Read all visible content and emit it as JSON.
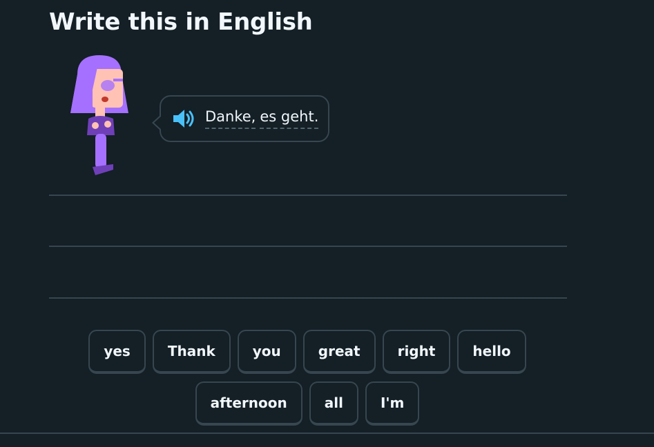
{
  "header": {
    "title": "Write this in English"
  },
  "prompt": {
    "words": [
      "Danke,",
      "es geht."
    ]
  },
  "word_bank": {
    "row1": [
      "yes",
      "Thank",
      "you",
      "great",
      "right",
      "hello"
    ],
    "row2": [
      "afternoon",
      "all",
      "I'm"
    ]
  },
  "colors": {
    "background": "#141f26",
    "border": "#37464f",
    "text": "#f1f7fb",
    "speaker": "#49c0f8",
    "character_hair": "#a570ff"
  }
}
